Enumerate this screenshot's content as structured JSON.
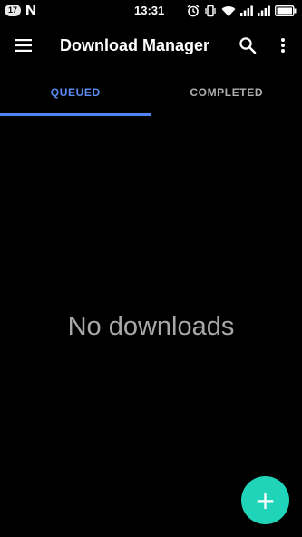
{
  "status_bar": {
    "notification_count": "17",
    "time": "13:31",
    "icons": [
      "n-logo-icon",
      "alarm-icon",
      "vibrate-icon",
      "wifi-icon",
      "signal-icon",
      "signal-icon",
      "battery-icon"
    ]
  },
  "app_bar": {
    "title": "Download Manager",
    "icons": [
      "menu-icon",
      "search-icon",
      "more-vert-icon"
    ]
  },
  "tabs": [
    {
      "label": "QUEUED",
      "selected": true
    },
    {
      "label": "COMPLETED",
      "selected": false
    }
  ],
  "main": {
    "empty_message": "No downloads"
  },
  "fab": {
    "icon": "add-icon",
    "symbol": "+"
  },
  "colors": {
    "background": "#000000",
    "accent": "#4f86f7",
    "fab": "#1fd4b8",
    "empty_text": "#a8a8a8"
  }
}
